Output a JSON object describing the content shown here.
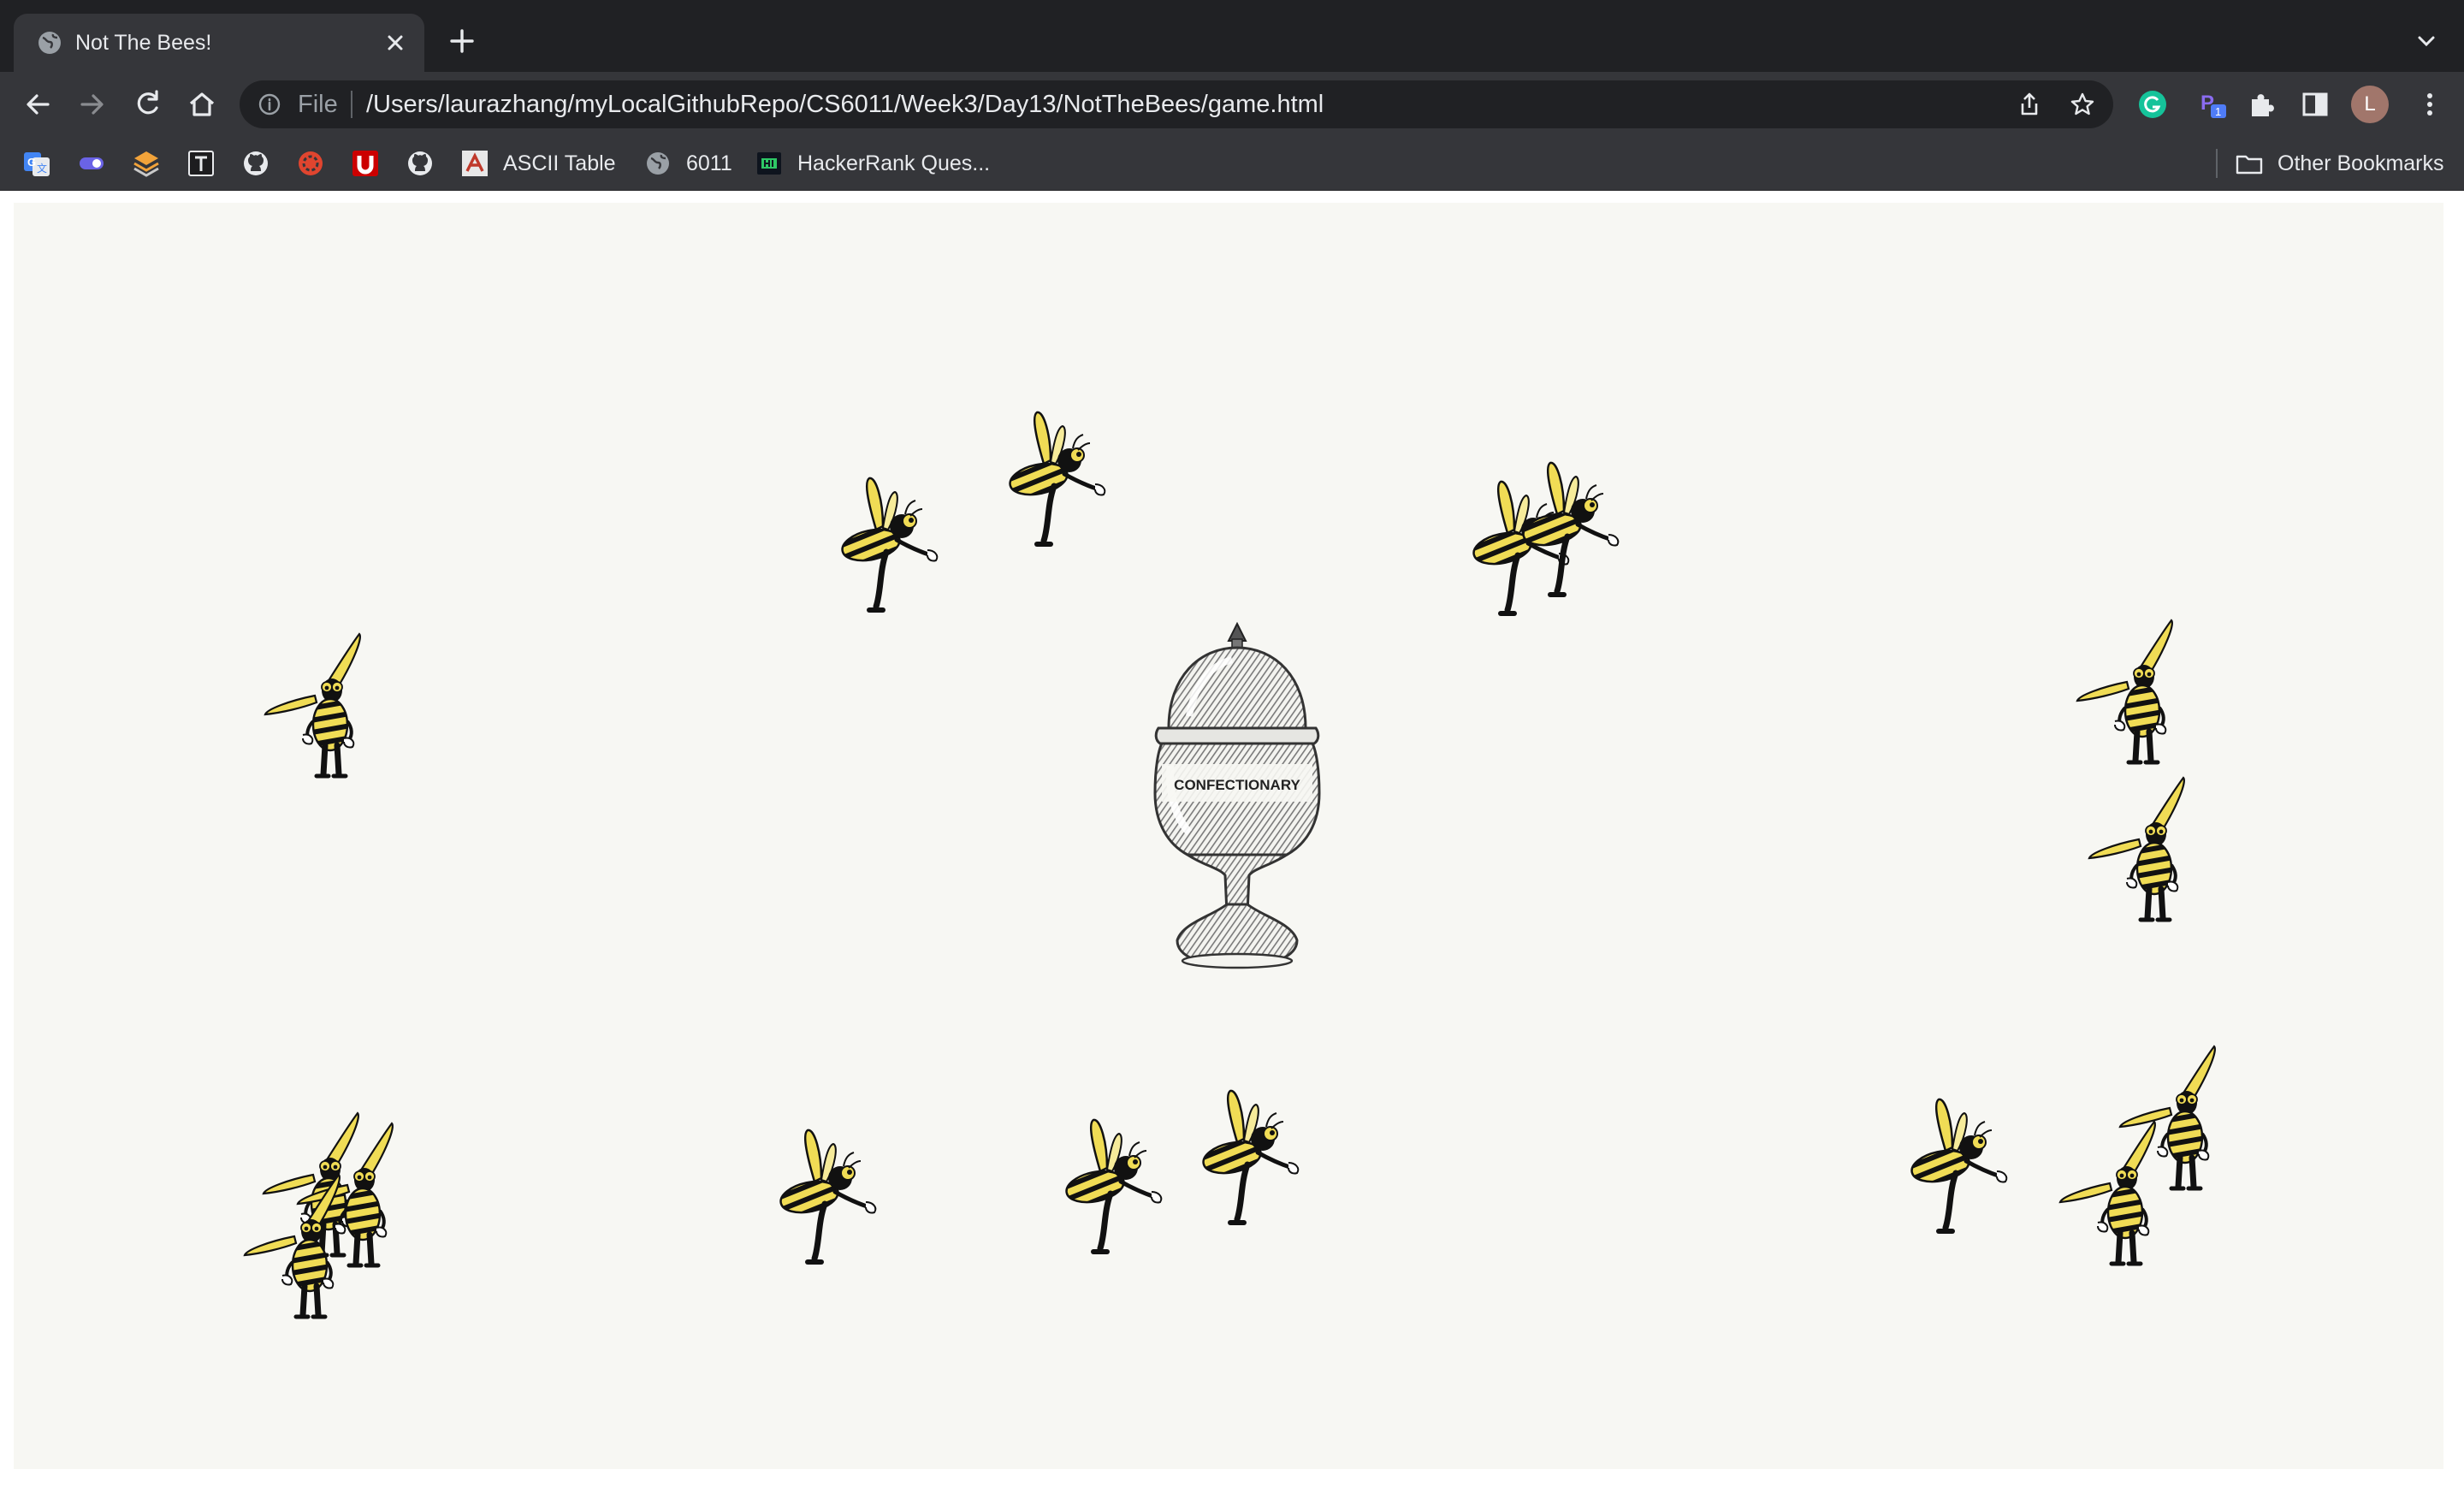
{
  "browser": {
    "tab": {
      "title": "Not The Bees!"
    },
    "omnibox": {
      "scheme": "File",
      "url": "/Users/laurazhang/myLocalGithubRepo/CS6011/Week3/Day13/NotTheBees/game.html"
    },
    "profile_initial": "L",
    "extension_badge": "1",
    "bookmarks": [
      {
        "label": "",
        "icon": "google-translate-icon"
      },
      {
        "label": "",
        "icon": "extension-toggle-icon"
      },
      {
        "label": "",
        "icon": "layers-icon"
      },
      {
        "label": "",
        "icon": "typora-icon"
      },
      {
        "label": "",
        "icon": "github-icon"
      },
      {
        "label": "",
        "icon": "compass-icon"
      },
      {
        "label": "",
        "icon": "utah-u-icon"
      },
      {
        "label": "",
        "icon": "github-icon"
      },
      {
        "label": "ASCII Table",
        "icon": "ascii-table-icon"
      },
      {
        "label": "6011",
        "icon": "globe-icon"
      },
      {
        "label": "HackerRank Ques...",
        "icon": "hackerrank-icon"
      }
    ],
    "other_bookmarks": "Other Bookmarks"
  },
  "game": {
    "jar_label": "CONFECTIONARY",
    "bee_count": 16,
    "colors": {
      "board": "#f7f7f3",
      "bee_yellow": "#f0dc55",
      "bee_black": "#111111"
    }
  }
}
